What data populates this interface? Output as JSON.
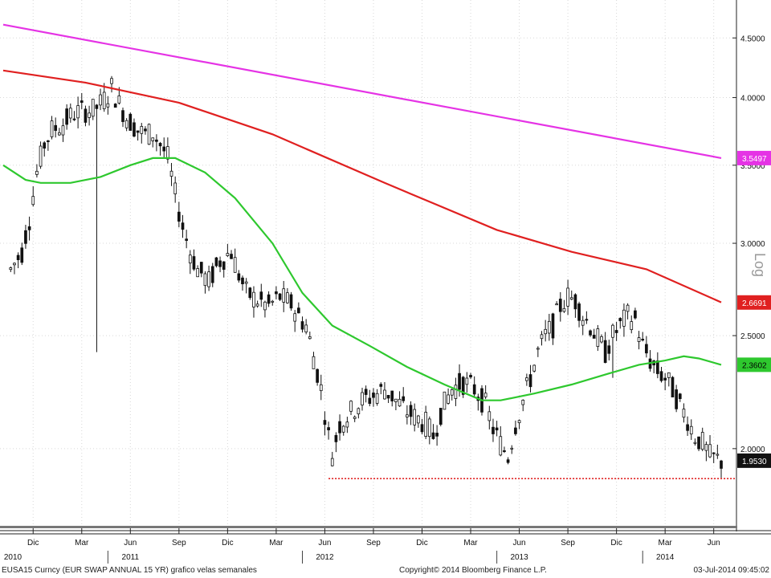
{
  "chart_data": {
    "type": "candlestick",
    "scale": "log",
    "y_ticks": [
      {
        "value": 2.0,
        "label": "2.0000"
      },
      {
        "value": 2.5,
        "label": "2.5000"
      },
      {
        "value": 3.0,
        "label": "3.0000"
      },
      {
        "value": 3.5,
        "label": "3.5000"
      },
      {
        "value": 4.0,
        "label": "4.0000"
      },
      {
        "value": 4.5,
        "label": "4.5000"
      }
    ],
    "ylim": [
      1.72,
      4.85
    ],
    "axis_note": "Log",
    "x_ticks": [
      {
        "week": 6,
        "label": "Dic"
      },
      {
        "week": 19,
        "label": "Mar"
      },
      {
        "week": 32,
        "label": "Jun"
      },
      {
        "week": 45,
        "label": "Sep"
      },
      {
        "week": 58,
        "label": "Dic"
      },
      {
        "week": 71,
        "label": "Mar"
      },
      {
        "week": 84,
        "label": "Jun"
      },
      {
        "week": 97,
        "label": "Sep"
      },
      {
        "week": 110,
        "label": "Dic"
      },
      {
        "week": 123,
        "label": "Mar"
      },
      {
        "week": 136,
        "label": "Jun"
      },
      {
        "week": 149,
        "label": "Sep"
      },
      {
        "week": 162,
        "label": "Dic"
      },
      {
        "week": 175,
        "label": "Mar"
      },
      {
        "week": 188,
        "label": "Jun"
      }
    ],
    "years": [
      {
        "week": 0,
        "label": "2010"
      },
      {
        "week": 32,
        "label": "2011"
      },
      {
        "week": 84,
        "label": "2012"
      },
      {
        "week": 136,
        "label": "2013"
      },
      {
        "week": 175,
        "label": "2014"
      }
    ],
    "close_points": [
      [
        0,
        2.85
      ],
      [
        3,
        2.95
      ],
      [
        5,
        3.15
      ],
      [
        7,
        3.45
      ],
      [
        9,
        3.65
      ],
      [
        11,
        3.75
      ],
      [
        14,
        3.8
      ],
      [
        17,
        3.88
      ],
      [
        20,
        3.9
      ],
      [
        22,
        3.9
      ],
      [
        24,
        3.95
      ],
      [
        26,
        4.02
      ],
      [
        27,
        4.08
      ],
      [
        29,
        3.95
      ],
      [
        31,
        3.85
      ],
      [
        34,
        3.75
      ],
      [
        36,
        3.72
      ],
      [
        38,
        3.73
      ],
      [
        40,
        3.65
      ],
      [
        42,
        3.55
      ],
      [
        44,
        3.3
      ],
      [
        46,
        3.1
      ],
      [
        48,
        2.95
      ],
      [
        50,
        2.85
      ],
      [
        53,
        2.78
      ],
      [
        56,
        2.9
      ],
      [
        59,
        2.95
      ],
      [
        61,
        2.82
      ],
      [
        63,
        2.72
      ],
      [
        66,
        2.68
      ],
      [
        69,
        2.65
      ],
      [
        72,
        2.7
      ],
      [
        75,
        2.66
      ],
      [
        77,
        2.6
      ],
      [
        79,
        2.55
      ],
      [
        81,
        2.4
      ],
      [
        83,
        2.25
      ],
      [
        85,
        2.05
      ],
      [
        86,
        1.98
      ],
      [
        88,
        2.1
      ],
      [
        91,
        2.15
      ],
      [
        94,
        2.2
      ],
      [
        97,
        2.22
      ],
      [
        100,
        2.25
      ],
      [
        103,
        2.2
      ],
      [
        106,
        2.15
      ],
      [
        109,
        2.12
      ],
      [
        111,
        2.1
      ],
      [
        113,
        2.05
      ],
      [
        115,
        2.15
      ],
      [
        118,
        2.25
      ],
      [
        121,
        2.28
      ],
      [
        124,
        2.25
      ],
      [
        127,
        2.18
      ],
      [
        129,
        2.08
      ],
      [
        131,
        2.02
      ],
      [
        133,
        1.97
      ],
      [
        135,
        2.1
      ],
      [
        137,
        2.2
      ],
      [
        139,
        2.3
      ],
      [
        141,
        2.42
      ],
      [
        143,
        2.5
      ],
      [
        145,
        2.55
      ],
      [
        147,
        2.65
      ],
      [
        149,
        2.7
      ],
      [
        151,
        2.68
      ],
      [
        153,
        2.6
      ],
      [
        155,
        2.55
      ],
      [
        157,
        2.48
      ],
      [
        159,
        2.42
      ],
      [
        161,
        2.5
      ],
      [
        163,
        2.55
      ],
      [
        165,
        2.6
      ],
      [
        167,
        2.58
      ],
      [
        169,
        2.45
      ],
      [
        171,
        2.38
      ],
      [
        173,
        2.33
      ],
      [
        175,
        2.3
      ],
      [
        177,
        2.25
      ],
      [
        179,
        2.18
      ],
      [
        181,
        2.12
      ],
      [
        183,
        2.05
      ],
      [
        185,
        2.02
      ],
      [
        187,
        1.97
      ],
      [
        190,
        1.95
      ]
    ],
    "spikes": [
      {
        "week": 23,
        "low": 2.42
      },
      {
        "week": 161,
        "low": 2.3
      }
    ],
    "series": [
      {
        "color": "#e533e5",
        "points": [
          [
            -2,
            4.62
          ],
          [
            190,
            3.55
          ]
        ]
      },
      {
        "color": "#e02020",
        "points": [
          [
            -2,
            4.22
          ],
          [
            20,
            4.12
          ],
          [
            45,
            3.96
          ],
          [
            70,
            3.72
          ],
          [
            100,
            3.38
          ],
          [
            130,
            3.08
          ],
          [
            150,
            2.95
          ],
          [
            170,
            2.85
          ],
          [
            190,
            2.67
          ]
        ]
      },
      {
        "color": "#2ec82e",
        "points": [
          [
            -2,
            3.5
          ],
          [
            4,
            3.4
          ],
          [
            8,
            3.38
          ],
          [
            16,
            3.38
          ],
          [
            24,
            3.42
          ],
          [
            32,
            3.5
          ],
          [
            38,
            3.55
          ],
          [
            44,
            3.55
          ],
          [
            52,
            3.45
          ],
          [
            60,
            3.28
          ],
          [
            70,
            3.0
          ],
          [
            78,
            2.72
          ],
          [
            86,
            2.55
          ],
          [
            96,
            2.45
          ],
          [
            106,
            2.35
          ],
          [
            116,
            2.27
          ],
          [
            126,
            2.2
          ],
          [
            131,
            2.2
          ],
          [
            140,
            2.23
          ],
          [
            150,
            2.27
          ],
          [
            160,
            2.32
          ],
          [
            168,
            2.36
          ],
          [
            175,
            2.38
          ],
          [
            180,
            2.4
          ],
          [
            184,
            2.39
          ],
          [
            190,
            2.36
          ]
        ]
      }
    ],
    "last_values": [
      {
        "label": "3.5497",
        "bg": "#e533e5",
        "fg": "#ffffff",
        "value": 3.5497
      },
      {
        "label": "2.6691",
        "bg": "#e02020",
        "fg": "#ffffff",
        "value": 2.6691
      },
      {
        "label": "2.3602",
        "bg": "#2ec82e",
        "fg": "#000000",
        "value": 2.3602
      },
      {
        "label": "1.9530",
        "bg": "#111111",
        "fg": "#ffffff",
        "value": 1.953
      }
    ],
    "support_level": 1.885,
    "support_range": [
      85,
      190
    ],
    "support_color": "#e02020"
  },
  "footer": {
    "left": "EUSA15 Curncy (EUR SWAP ANNUAL 15 YR) grafico velas semanales",
    "center": "Copyright© 2014 Bloomberg Finance L.P.",
    "right": "03-Jul-2014 09:45:02"
  }
}
